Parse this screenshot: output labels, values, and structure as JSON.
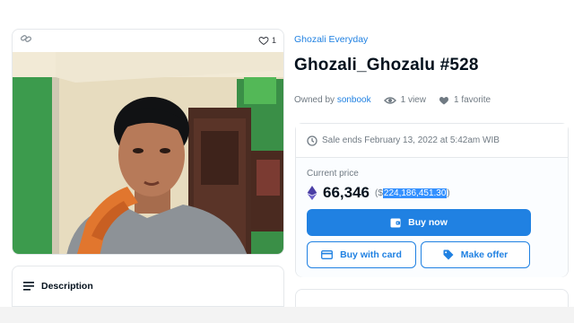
{
  "item_card": {
    "favorite_count": "1",
    "photo_alt": ""
  },
  "description": {
    "label": "Description"
  },
  "collection_name": "Ghozali Everyday",
  "item_title": "Ghozali_Ghozalu #528",
  "meta": {
    "owned_by_label": "Owned by",
    "owner": "sonbook",
    "views": "1 view",
    "favorites": "1 favorite"
  },
  "sale": {
    "ends_text": "Sale ends February 13, 2022 at 5:42am WIB",
    "current_price_label": "Current price",
    "price_eth": "66,346",
    "usd_prefix": "($",
    "usd_value": "224,186,451.30",
    "usd_suffix": ")",
    "buy_now_label": "Buy now",
    "buy_with_card_label": "Buy with card",
    "make_offer_label": "Make offer"
  },
  "colors": {
    "accent": "#2081e2",
    "text_primary": "#04111d",
    "text_secondary": "#707a83",
    "highlight": "#3390ff"
  },
  "icons": [
    "chain-icon",
    "heart-outline-icon",
    "lines-icon",
    "eye-icon",
    "heart-filled-icon",
    "clock-icon",
    "eth-icon",
    "wallet-icon",
    "card-icon",
    "tag-icon"
  ]
}
